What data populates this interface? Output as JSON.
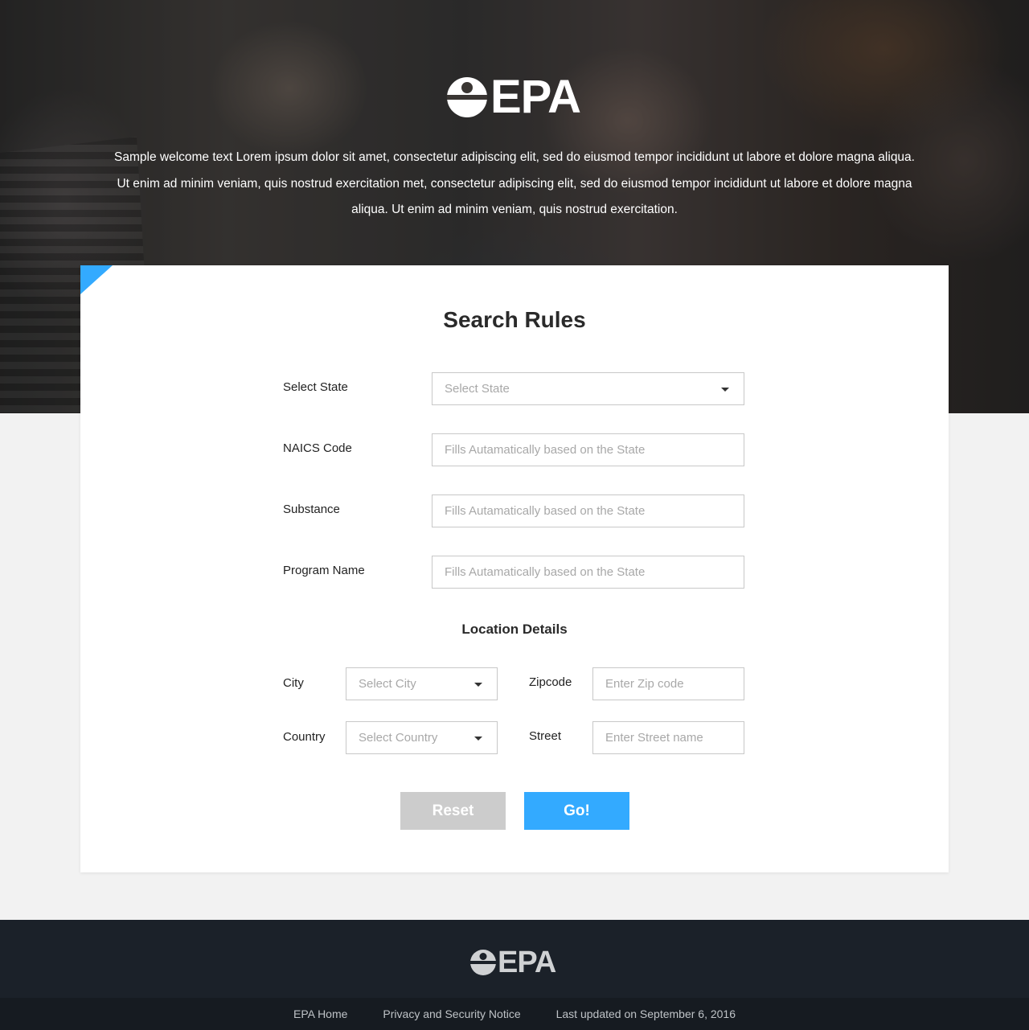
{
  "hero": {
    "logo_text": "EPA",
    "welcome_text": "Sample welcome text Lorem ipsum dolor sit amet, consectetur adipiscing elit, sed do eiusmod tempor incididunt ut labore et dolore magna aliqua. Ut enim ad minim veniam, quis nostrud exercitation met, consectetur adipiscing elit, sed do eiusmod tempor incididunt ut labore et dolore magna aliqua. Ut enim ad minim veniam, quis nostrud exercitation."
  },
  "form": {
    "title": "Search Rules",
    "state": {
      "label": "Select State",
      "placeholder": "Select State"
    },
    "naics": {
      "label": "NAICS Code",
      "placeholder": "Fills Autamatically based on the State"
    },
    "substance": {
      "label": "Substance",
      "placeholder": "Fills Autamatically based on the State"
    },
    "program": {
      "label": "Program Name",
      "placeholder": "Fills Autamatically based on the State"
    },
    "location_title": "Location Details",
    "city": {
      "label": "City",
      "placeholder": "Select City"
    },
    "zipcode": {
      "label": "Zipcode",
      "placeholder": "Enter Zip code"
    },
    "country": {
      "label": "Country",
      "placeholder": "Select Country"
    },
    "street": {
      "label": "Street",
      "placeholder": "Enter Street name"
    },
    "reset_label": "Reset",
    "go_label": "Go!"
  },
  "footer": {
    "logo_text": "EPA",
    "links": [
      "EPA Home",
      "Privacy and Security Notice"
    ],
    "updated": "Last updated on September 6, 2016"
  },
  "colors": {
    "accent": "#33aaff",
    "reset_button": "#cccccc",
    "footer_bg": "#1b2129",
    "page_bg": "#f2f2f2"
  },
  "icons": {
    "logo": "epa-logo-icon",
    "dropdown": "caret-down-icon"
  }
}
